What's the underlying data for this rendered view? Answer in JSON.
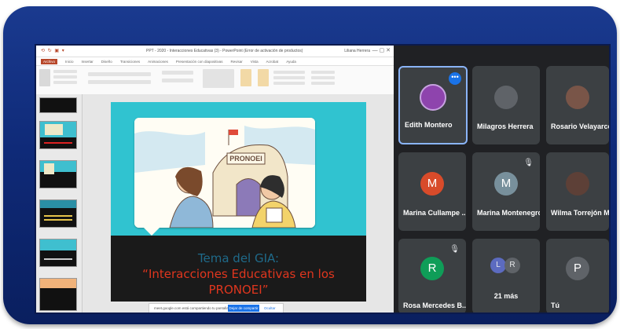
{
  "ppt": {
    "quick_access": "⟲ ↻ ▣ ▾",
    "title": "PPT - 2020 - Interacciones Educativas (3) - PowerPoint (Error de activación de productos)",
    "user": "Liliana Herrera",
    "tabs": [
      "Archivo",
      "Inicio",
      "Insertar",
      "Diseño",
      "Transiciones",
      "Animaciones",
      "Presentación con diapositivas",
      "Revisar",
      "Vista",
      "Acrobat",
      "Ayuda"
    ],
    "share_bar": {
      "message": "meet.google.com está compartiendo tu pantalla.",
      "stop_label": "Dejar de compartir",
      "hide_label": "Ocultar"
    }
  },
  "slide": {
    "sign_text": "PRONOEI",
    "topic_label": "Tema del GIA:",
    "quote_line1": "“Interacciones Educativas en los",
    "quote_line2": "PRONOEI”"
  },
  "meet": {
    "participants": [
      {
        "name": "Edith Montero",
        "initial": "",
        "color": "#8e44ad",
        "active": true,
        "photo": true
      },
      {
        "name": "Milagros Herrera",
        "initial": "",
        "color": "#5f6368",
        "photo": true
      },
      {
        "name": "Rosario Velayarce ...",
        "initial": "",
        "color": "#795548",
        "photo": true
      },
      {
        "name": "Marina Cullampe ...",
        "initial": "M",
        "color": "#d84b2a"
      },
      {
        "name": "Marina Montenegro",
        "initial": "M",
        "color": "#78909c"
      },
      {
        "name": "Wilma Torrejón M...",
        "initial": "",
        "color": "#5d4037",
        "photo": true
      },
      {
        "name": "Rosa Mercedes B...",
        "initial": "R",
        "color": "#0f9d58"
      },
      {
        "name": "21 más",
        "initial": "",
        "color": "#3c4043",
        "more": true,
        "badges": [
          "L",
          "R"
        ]
      },
      {
        "name": "Tú",
        "initial": "P",
        "color": "#5f6368"
      }
    ]
  }
}
